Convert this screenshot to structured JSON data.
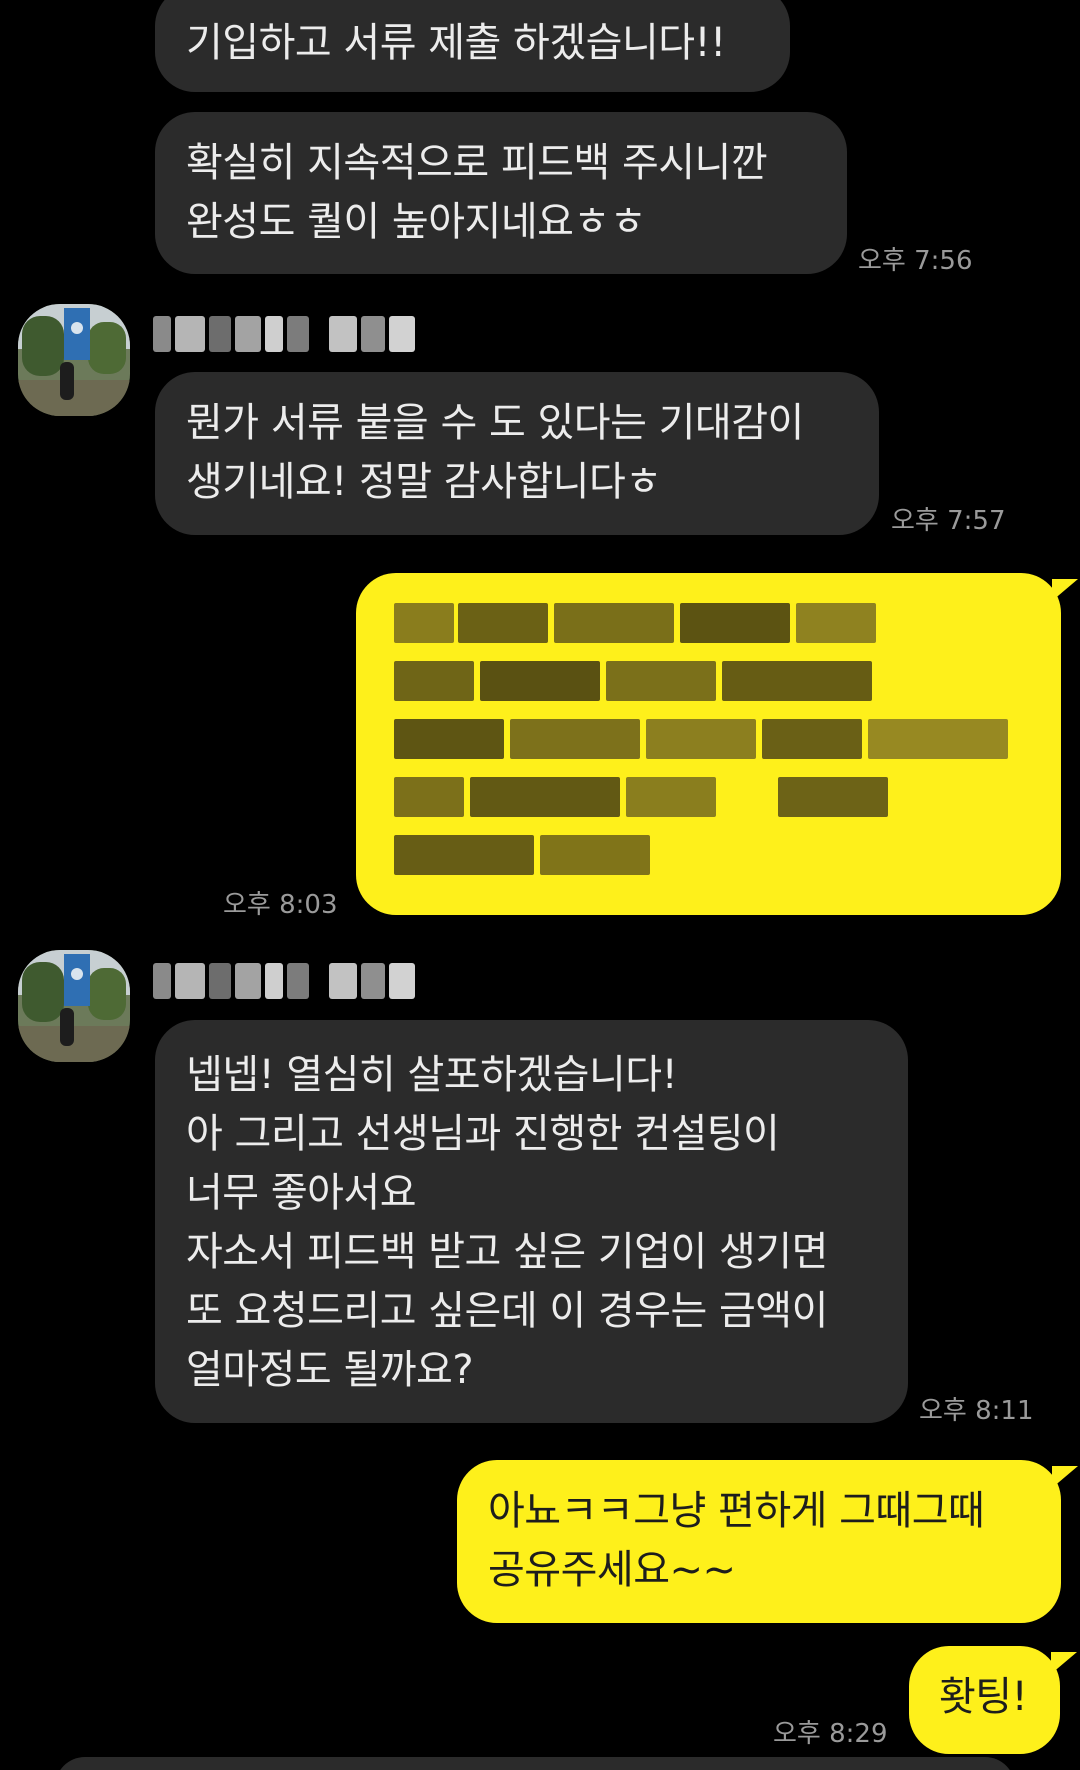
{
  "messages": {
    "m1": {
      "text": "기입하고 서류 제출 하겠습니다!!"
    },
    "m2": {
      "text": "확실히 지속적으로 피드백 주시니깐\n완성도 퀄이 높아지네요ㅎㅎ",
      "time": "오후 7:56"
    },
    "m3": {
      "text": "뭔가 서류 붙을 수 도 있다는 기대감이\n생기네요! 정말 감사합니다ㅎ",
      "time": "오후 7:57"
    },
    "m4": {
      "time": "오후 8:03"
    },
    "m5": {
      "text": "넵넵! 열심히 살포하겠습니다!\n아 그리고 선생님과 진행한 컨설팅이\n너무 좋아서요\n자소서 피드백 받고 싶은 기업이 생기면\n또 요청드리고 싶은데 이 경우는 금액이\n얼마정도 될까요?",
      "time": "오후 8:11"
    },
    "m6": {
      "text": "아뇨ㅋㅋ그냥 편하게 그때그때\n공유주세요~~"
    },
    "m7": {
      "text": "홧팅!",
      "time": "오후 8:29"
    }
  },
  "colors": {
    "background": "#000000",
    "incoming_bubble": "#2b2b2b",
    "outgoing_bubble": "#fef01b",
    "timestamp": "#9a9a9a"
  }
}
